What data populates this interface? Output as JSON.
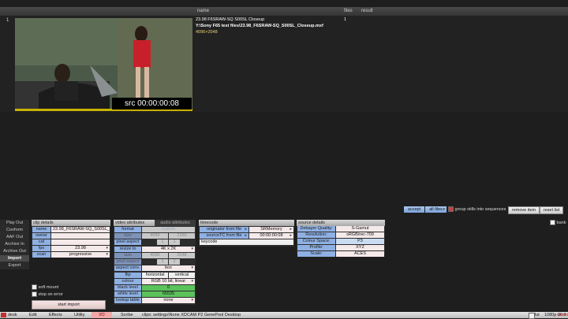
{
  "list": {
    "headers": {
      "name": "name",
      "files": "files",
      "result": "result"
    },
    "row": {
      "index": "1",
      "title": "23.98 F6SRAW-SQ S00SL Closeup",
      "path": "Y:\\Sony F65 test files\\23.98_F6SRAW-SQ_S00SL_Closeup.mxf",
      "resolution": "4096×2048",
      "files": "1",
      "timecode": "src 00:00:00:08"
    }
  },
  "actions": {
    "accept": "accept",
    "all_files": "all files",
    "group_stills": "group stills into sequences",
    "remove_item": "remove item",
    "reset_list": "reset list",
    "bank": "bank"
  },
  "nav": {
    "items": [
      "Play Out",
      "Conform",
      "AAF Out",
      "Archive In",
      "Archive Out",
      "Import",
      "Export"
    ],
    "active": "Import"
  },
  "clip_details": {
    "title": "clip details",
    "name_label": "name",
    "name_value": "23.98_F6SRAW-SQ_S00SL_Cl",
    "owner_label": "owner",
    "cat_label": "cat",
    "fps_label": "fps",
    "fps_value": "23.98",
    "scan_label": "scan",
    "scan_value": "progressive",
    "soft_mount": "soft mount",
    "stop_on_error": "stop on error",
    "start_import": "start import"
  },
  "video": {
    "tab_video": "video attributes",
    "tab_audio": "audio attributes",
    "format_label": "format",
    "format_value": "custom",
    "size_label": "size",
    "size_w": "4096",
    "size_h": "2160",
    "pixel_aspect_label": "pixel aspect",
    "pa_a": "1",
    "pa_b": "1",
    "resize_label": "resize to",
    "resize_value": "4K x 2K",
    "size2_label": "size",
    "size2_w": "4096",
    "size2_h": "2048",
    "pixel_aspect2_label": "pixel aspect",
    "pa2_a": "1",
    "pa2_b": "1",
    "aspect_conv_label": "aspect conv.",
    "aspect_conv_value": "box",
    "flip_label": "flip",
    "horizontal": "horizontal",
    "vertical": "vertical",
    "colour_label": "colour",
    "colour_value": "RGB 10 bit, linear",
    "black_label": "black level",
    "black_value": "0",
    "white_label": "white level",
    "white_value": "65535",
    "lut_label": "lookup table",
    "lut_value": "none"
  },
  "timecode": {
    "title": "timecode",
    "origin_label": "originator from file",
    "origin_value": "SRMemory",
    "source_label": "sourceTC from file",
    "source_value": "00:00:00:08",
    "keycode_label": "keycode"
  },
  "source": {
    "title": "source details",
    "rows": [
      {
        "label": "Debayer Quality:",
        "value": "S-Gamut"
      },
      {
        "label": "Resolution:",
        "value": "sRGB/rec-709"
      },
      {
        "label": "Colour Space:",
        "value": "P3"
      },
      {
        "label": "Profile:",
        "value": "XYZ"
      },
      {
        "label": "Scale:",
        "value": "ACES"
      }
    ]
  },
  "bottombar": {
    "items": [
      "desk",
      "Edit",
      "Effects",
      "Utility",
      "I/O",
      "Scribe",
      "clips: settings\\None XDCAM P2 GenePool Desktop"
    ],
    "lut": "lut",
    "format": "1080p 16:9",
    "vtr": "vtr",
    "exit": "exit"
  }
}
